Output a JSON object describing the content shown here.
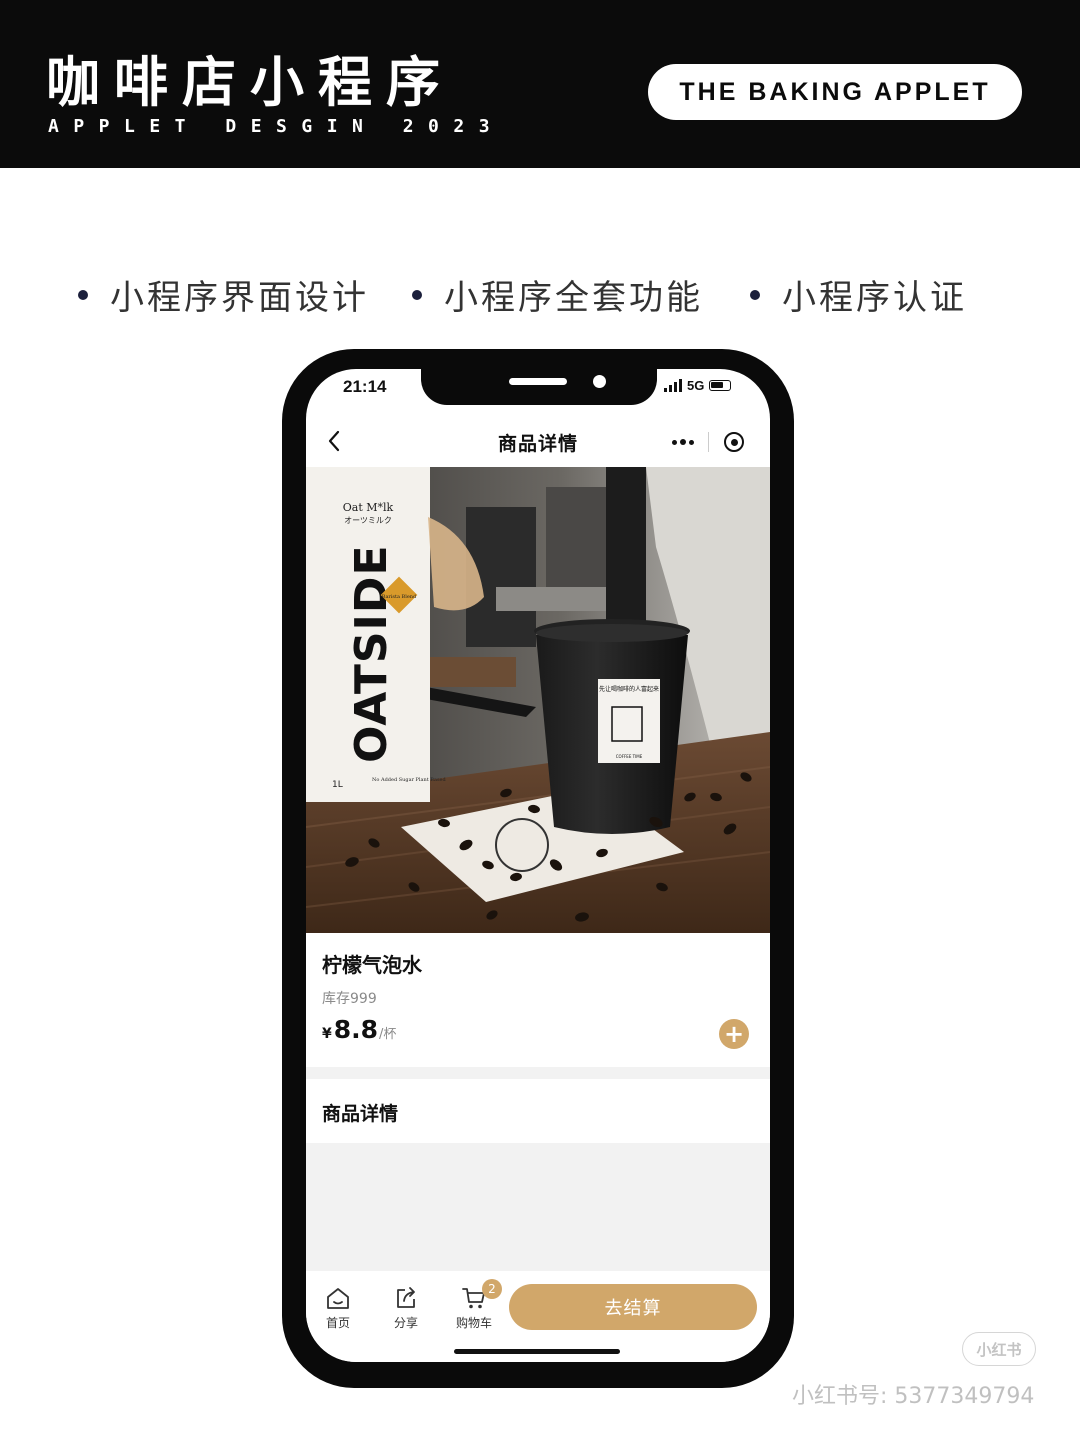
{
  "banner": {
    "title": "咖啡店小程序",
    "subtitle": "APPLET DESGIN 2023",
    "pill": "THE BAKING APPLET"
  },
  "features": [
    "小程序界面设计",
    "小程序全套功能",
    "小程序认证"
  ],
  "status": {
    "time": "21:14",
    "network": "5G"
  },
  "nav": {
    "title": "商品详情"
  },
  "product": {
    "name": "柠檬气泡水",
    "stock": "库存999",
    "currency": "¥",
    "price": "8.8",
    "unit": "/杯",
    "image_text": {
      "carton_brand": "OATSIDE",
      "carton_line1": "Oat M*lk",
      "carton_line2": "オーツミルク",
      "carton_volume": "1L",
      "carton_badge": "Barista Blend",
      "carton_footer": "No Added Sugar Plant Based",
      "cup_label": "先让喝咖啡的人富起来",
      "cup_footer": "COFFEE TIME"
    }
  },
  "detail_section": {
    "title": "商品详情"
  },
  "bottom_bar": {
    "tabs": [
      {
        "label": "首页",
        "icon": "home-icon"
      },
      {
        "label": "分享",
        "icon": "share-icon"
      },
      {
        "label": "购物车",
        "icon": "cart-icon",
        "badge": "2"
      }
    ],
    "checkout_label": "去结算"
  },
  "colors": {
    "accent": "#d1a76a",
    "banner": "#0b0b0b"
  },
  "watermark": {
    "logo": "小红书",
    "text": "小红书号: 5377349794"
  }
}
